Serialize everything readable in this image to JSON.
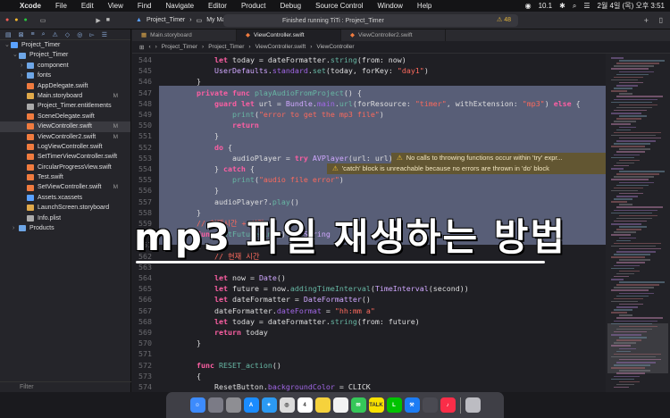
{
  "menubar": {
    "app": "Xcode",
    "items": [
      "File",
      "Edit",
      "View",
      "Find",
      "Navigate",
      "Editor",
      "Product",
      "Debug",
      "Source Control",
      "Window",
      "Help"
    ],
    "battery": "10.1",
    "clock": "2월 4일 (목) 오후 3:51"
  },
  "toolbar": {
    "project": "Project_Timer",
    "device": "My Mac",
    "status": "Finished running TiTi : Project_Timer",
    "warning_count": "48"
  },
  "navigator": {
    "filter_placeholder": "Filter",
    "items": [
      {
        "label": "Project_Timer",
        "depth": 0,
        "kind": "project",
        "badge": ""
      },
      {
        "label": "Project_Timer",
        "depth": 1,
        "kind": "folder",
        "badge": ""
      },
      {
        "label": "component",
        "depth": 2,
        "kind": "folder",
        "badge": ""
      },
      {
        "label": "fonts",
        "depth": 2,
        "kind": "folder",
        "badge": ""
      },
      {
        "label": "AppDelegate.swift",
        "depth": 2,
        "kind": "swift",
        "badge": ""
      },
      {
        "label": "Main.storyboard",
        "depth": 2,
        "kind": "storyboard",
        "badge": "M"
      },
      {
        "label": "Project_Timer.entitlements",
        "depth": 2,
        "kind": "file",
        "badge": ""
      },
      {
        "label": "SceneDelegate.swift",
        "depth": 2,
        "kind": "swift",
        "badge": ""
      },
      {
        "label": "ViewController.swift",
        "depth": 2,
        "kind": "swift",
        "badge": "M",
        "selected": true
      },
      {
        "label": "ViewController2.swift",
        "depth": 2,
        "kind": "swift",
        "badge": "M"
      },
      {
        "label": "LogViewController.swift",
        "depth": 2,
        "kind": "swift",
        "badge": ""
      },
      {
        "label": "SetTimerViewController.swift",
        "depth": 2,
        "kind": "swift",
        "badge": ""
      },
      {
        "label": "CircularProgressView.swift",
        "depth": 2,
        "kind": "swift",
        "badge": ""
      },
      {
        "label": "Test.swift",
        "depth": 2,
        "kind": "swift",
        "badge": ""
      },
      {
        "label": "SetViewController.swift",
        "depth": 2,
        "kind": "swift",
        "badge": "M"
      },
      {
        "label": "Assets.xcassets",
        "depth": 2,
        "kind": "assets",
        "badge": ""
      },
      {
        "label": "LaunchScreen.storyboard",
        "depth": 2,
        "kind": "storyboard",
        "badge": ""
      },
      {
        "label": "Info.plist",
        "depth": 2,
        "kind": "file",
        "badge": ""
      },
      {
        "label": "Products",
        "depth": 1,
        "kind": "folder",
        "badge": ""
      }
    ]
  },
  "tabs": [
    {
      "label": "Main.storyboard",
      "active": false
    },
    {
      "label": "ViewController.swift",
      "active": true
    },
    {
      "label": "ViewController2.swift",
      "active": false
    }
  ],
  "jumpbar": [
    "Project_Timer",
    "Project_Timer",
    "ViewController.swift",
    "ViewController"
  ],
  "code_lines": [
    {
      "n": "544",
      "html": "        <span class='kw'>let</span> today = dateFormatter.<span class='fn'>string</span>(from: now)"
    },
    {
      "n": "545",
      "html": "        <span class='ty'>UserDefaults</span>.<span class='pr'>standard</span>.<span class='fn'>set</span>(today, forKey: <span class='str'>\"day1\"</span>)"
    },
    {
      "n": "546",
      "html": "    }"
    },
    {
      "n": "547",
      "html": "    <span class='kw'>private func</span> <span class='fn'>playAudioFromProject</span>() {"
    },
    {
      "n": "548",
      "html": "        <span class='kw'>guard let</span> url = <span class='ty'>Bundle</span>.<span class='pr'>main</span>.<span class='fn'>url</span>(forResource: <span class='str'>\"timer\"</span>, withExtension: <span class='str'>\"mp3\"</span>) <span class='kw'>else</span> {"
    },
    {
      "n": "549",
      "html": "            <span class='fn'>print</span>(<span class='str'>\"error to get the mp3 file\"</span>)"
    },
    {
      "n": "550",
      "html": "            <span class='kw'>return</span>"
    },
    {
      "n": "551",
      "html": "        }"
    },
    {
      "n": "552",
      "html": "        <span class='kw'>do</span> {"
    },
    {
      "n": "553",
      "html": "            audioPlayer = <span class='kw'>try</span> <span class='ty'>AVPlayer</span>(url: url)"
    },
    {
      "n": "554",
      "html": "        } <span class='kw'>catch</span> {"
    },
    {
      "n": "555",
      "html": "            <span class='fn'>print</span>(<span class='str'>\"audio file error\"</span>)"
    },
    {
      "n": "556",
      "html": "        }"
    },
    {
      "n": "557",
      "html": "        audioPlayer?.<span class='fn'>play</span>()"
    },
    {
      "n": "558",
      "html": "    }"
    },
    {
      "n": "559",
      "html": "    <span class='str'>// 현재시간 + 시간</span>"
    },
    {
      "n": "560",
      "html": "    <span class='kw'>func</span> <span class='fn'>getFutureTime</span>() -> <span class='ty'>String</span>"
    },
    {
      "n": "561",
      "html": "    {"
    },
    {
      "n": "562",
      "html": "        <span class='str'>// 현재 시간</span>"
    },
    {
      "n": "563",
      "html": "        "
    },
    {
      "n": "564",
      "html": "        <span class='kw'>let</span> now = <span class='ty'>Date</span>()"
    },
    {
      "n": "565",
      "html": "        <span class='kw'>let</span> future = now.<span class='fn'>addingTimeInterval</span>(<span class='ty'>TimeInterval</span>(second))"
    },
    {
      "n": "566",
      "html": "        <span class='kw'>let</span> dateFormatter = <span class='ty'>DateFormatter</span>()"
    },
    {
      "n": "567",
      "html": "        dateFormatter.<span class='pr'>dateFormat</span> = <span class='str'>\"hh:mm a\"</span>"
    },
    {
      "n": "568",
      "html": "        <span class='kw'>let</span> today = dateFormatter.<span class='fn'>string</span>(from: future)"
    },
    {
      "n": "569",
      "html": "        <span class='kw'>return</span> today"
    },
    {
      "n": "570",
      "html": "    }"
    },
    {
      "n": "571",
      "html": "    "
    },
    {
      "n": "572",
      "html": "    <span class='kw'>func</span> <span class='fn'>RESET_action</span>()"
    },
    {
      "n": "573",
      "html": "    {"
    },
    {
      "n": "574",
      "html": "        ResetButton.<span class='pr'>backgroundColor</span> = CLICK"
    },
    {
      "n": "575",
      "html": "        ResetButton.<span class='fn'>setTitleColor</span>(<span class='ty'>UIColor</span>.<span class='pr'>white</span>, for: .<span class='pr'>normal</span>)"
    }
  ],
  "warnings": [
    {
      "line": "553",
      "text": "No calls to throwing functions occur within 'try' expr..."
    },
    {
      "line": "554",
      "text": "'catch' block is unreachable because no errors are thrown in 'do' block"
    }
  ],
  "overlay_title": "mp3 파일 재생하는 방법",
  "dock": [
    "finder",
    "launchpad",
    "settings",
    "appstore",
    "safari",
    "chrome",
    "calendar",
    "notes",
    "reminders",
    "messages",
    "kakaotalk",
    "line",
    "xcode",
    "simulator",
    "music",
    "trash"
  ],
  "colors": {
    "selection": "#636a86",
    "warning": "#f1c232",
    "keyword": "#fc5fa3",
    "string": "#fc6a5d"
  }
}
